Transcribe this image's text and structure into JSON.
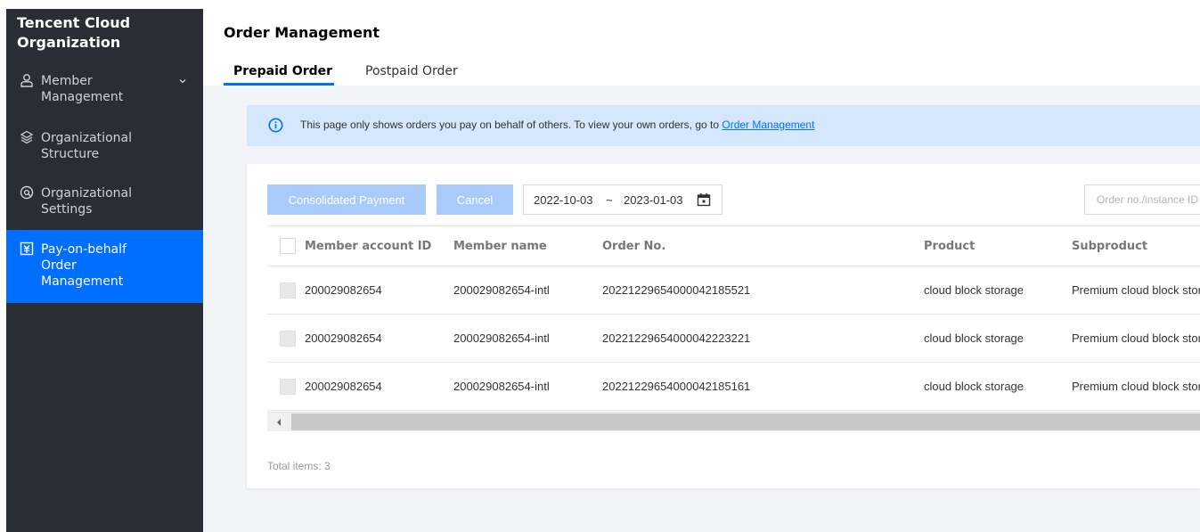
{
  "sidebar": {
    "title": "Tencent Cloud Organization",
    "items": [
      {
        "label": "Member Management",
        "icon": "user-icon"
      },
      {
        "label": "Organizational Structure",
        "icon": "structure-icon"
      },
      {
        "label": "Organizational Settings",
        "icon": "settings-icon"
      },
      {
        "label": "Pay-on-behalf Order Management",
        "icon": "order-icon"
      }
    ]
  },
  "header": {
    "title": "Order Management",
    "tabs": [
      {
        "label": "Prepaid Order"
      },
      {
        "label": "Postpaid Order"
      }
    ]
  },
  "notice": {
    "text": "This page only shows orders you pay on behalf of others. To view your own orders, go to ",
    "link": "Order Management"
  },
  "toolbar": {
    "consolidated_label": "Consolidated Payment",
    "cancel_label": "Cancel",
    "date_start": "2022-10-03",
    "date_sep": "~",
    "date_end": "2023-01-03",
    "search_placeholder": "Order no./instance ID"
  },
  "table": {
    "columns": [
      "Member account ID",
      "Member name",
      "Order No.",
      "Product",
      "Subproduct"
    ],
    "rows": [
      {
        "account": "200029082654",
        "name": "200029082654-intl",
        "order": "20221229654000042185521",
        "product": "cloud block storage",
        "subproduct": "Premium cloud block storage"
      },
      {
        "account": "200029082654",
        "name": "200029082654-intl",
        "order": "20221229654000042223221",
        "product": "cloud block storage",
        "subproduct": "Premium cloud block storage"
      },
      {
        "account": "200029082654",
        "name": "200029082654-intl",
        "order": "20221229654000042185161",
        "product": "cloud block storage",
        "subproduct": "Premium cloud block storage"
      }
    ]
  },
  "footer": {
    "total": "Total items: 3"
  },
  "colors": {
    "sidebar_bg": "#2a2d35",
    "accent": "#006eff",
    "notice_bg": "#d5e7fd",
    "disabled_button": "#a8cbfb"
  }
}
